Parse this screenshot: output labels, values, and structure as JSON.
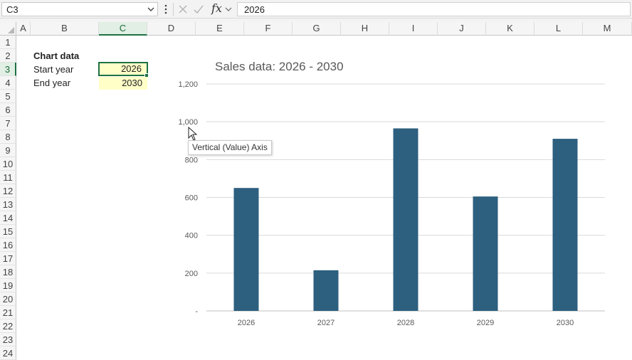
{
  "formula_bar": {
    "name_box": "C3",
    "formula": "2026",
    "fx_label": "fx"
  },
  "columns": [
    "A",
    "B",
    "C",
    "D",
    "E",
    "F",
    "G",
    "H",
    "I",
    "J",
    "K",
    "L",
    "M"
  ],
  "selected_column": "C",
  "rows": [
    "1",
    "2",
    "3",
    "4",
    "5",
    "6",
    "7",
    "8",
    "9",
    "10",
    "11",
    "12",
    "13",
    "14",
    "15",
    "16",
    "17",
    "18",
    "19",
    "20",
    "21",
    "22",
    "23",
    "24"
  ],
  "selected_row": "3",
  "sheet": {
    "b2": "Chart data",
    "b3": "Start year",
    "c3": "2026",
    "b4": "End year",
    "c4": "2030"
  },
  "tooltip": "Vertical (Value) Axis",
  "colors": {
    "bar": "#2d5f7f",
    "gridline": "#d9d9d9",
    "selection": "#1e7145",
    "input_fill": "#ffffc8"
  },
  "chart_data": {
    "type": "bar",
    "title": "Sales data: 2026 - 2030",
    "categories": [
      "2026",
      "2027",
      "2028",
      "2029",
      "2030"
    ],
    "values": [
      650,
      215,
      965,
      605,
      910
    ],
    "ylim": [
      0,
      1200
    ],
    "yticks": [
      0,
      200,
      400,
      600,
      800,
      1000,
      1200
    ],
    "ytick_labels": [
      "-",
      "200",
      "400",
      "600",
      "800",
      "1,000",
      "1,200"
    ],
    "xlabel": "",
    "ylabel": "",
    "grid": true,
    "legend": "none"
  }
}
